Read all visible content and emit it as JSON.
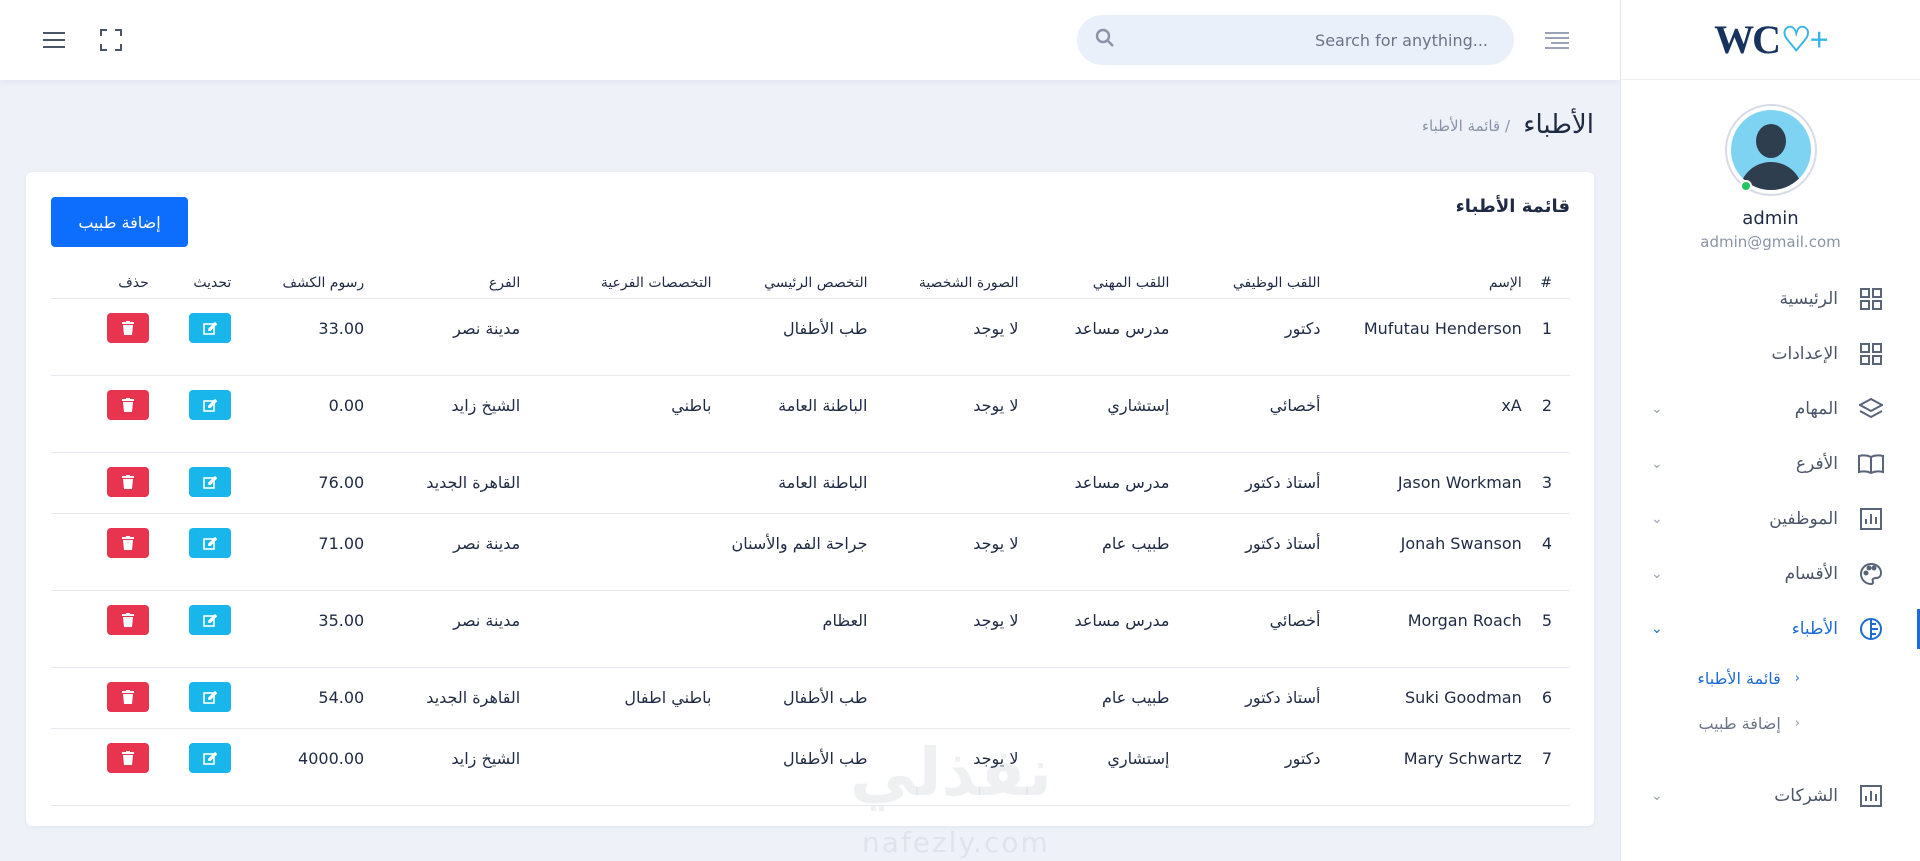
{
  "brand": {
    "logo_text": "WC",
    "logo_plus": "♡+"
  },
  "topbar": {
    "search_placeholder": "Search for anything..."
  },
  "profile": {
    "name": "admin",
    "email": "admin@gmail.com"
  },
  "menu": [
    {
      "label": "الرئيسية",
      "icon": "dashboard-icon",
      "chevron": false
    },
    {
      "label": "الإعدادات",
      "icon": "settings-grid-icon",
      "chevron": false
    },
    {
      "label": "المهام",
      "icon": "layers-icon",
      "chevron": true
    },
    {
      "label": "الأفرع",
      "icon": "book-icon",
      "chevron": true
    },
    {
      "label": "الموظفين",
      "icon": "bar-chart-icon",
      "chevron": true
    },
    {
      "label": "الأقسام",
      "icon": "palette-icon",
      "chevron": true
    },
    {
      "label": "الأطباء",
      "icon": "doctor-icon",
      "chevron": true,
      "active": true
    },
    {
      "label": "الشركات",
      "icon": "bar-chart-icon",
      "chevron": true
    }
  ],
  "submenu": [
    {
      "label": "قائمة الأطباء",
      "active": true
    },
    {
      "label": "إضافة طبيب",
      "active": false
    }
  ],
  "page": {
    "title": "الأطباء",
    "breadcrumb": "/ قائمة الأطباء"
  },
  "card": {
    "title": "قائمة الأطباء",
    "add_button": "إضافة طبيب"
  },
  "table": {
    "headers": [
      "#",
      "الإسم",
      "اللقب الوظيفي",
      "اللقب المهني",
      "الصورة الشخصية",
      "التخصص الرئيسي",
      "التخصصات الفرعية",
      "الفرع",
      "رسوم الكشف",
      "تحديث",
      "حذف"
    ],
    "rows": [
      {
        "num": "1",
        "name": "Mufutau Henderson",
        "job": "دكتور",
        "prof": "مدرس مساعد",
        "photo": "لا يوجد",
        "main": "طب الأطفال",
        "sub": "",
        "branch": "مدينة نصر",
        "fee": "33.00",
        "size": "tall"
      },
      {
        "num": "2",
        "name": "xA",
        "job": "أخصائي",
        "prof": "إستشاري",
        "photo": "لا يوجد",
        "main": "الباطنة العامة",
        "sub": "باطني",
        "branch": "الشيخ زايد",
        "fee": "0.00",
        "size": "tall"
      },
      {
        "num": "3",
        "name": "Jason Workman",
        "job": "أستاذ دكتور",
        "prof": "مدرس مساعد",
        "photo": "",
        "main": "الباطنة العامة",
        "sub": "",
        "branch": "القاهرة الجديد",
        "fee": "76.00",
        "size": "short"
      },
      {
        "num": "4",
        "name": "Jonah Swanson",
        "job": "أستاذ دكتور",
        "prof": "طبيب عام",
        "photo": "لا يوجد",
        "main": "جراحة الفم والأسنان",
        "sub": "",
        "branch": "مدينة نصر",
        "fee": "71.00",
        "size": "tall"
      },
      {
        "num": "5",
        "name": "Morgan Roach",
        "job": "أخصائي",
        "prof": "مدرس مساعد",
        "photo": "لا يوجد",
        "main": "العظام",
        "sub": "",
        "branch": "مدينة نصر",
        "fee": "35.00",
        "size": "tall"
      },
      {
        "num": "6",
        "name": "Suki Goodman",
        "job": "أستاذ دكتور",
        "prof": "طبيب عام",
        "photo": "",
        "main": "طب الأطفال",
        "sub": "باطني اطفال",
        "branch": "القاهرة الجديد",
        "fee": "54.00",
        "size": "short"
      },
      {
        "num": "7",
        "name": "Mary Schwartz",
        "job": "دكتور",
        "prof": "إستشاري",
        "photo": "لا يوجد",
        "main": "طب الأطفال",
        "sub": "",
        "branch": "الشيخ زايد",
        "fee": "4000.00",
        "size": "tall"
      }
    ]
  },
  "watermark": {
    "arabic": "نفذلي",
    "latin": "nafezly.com"
  }
}
